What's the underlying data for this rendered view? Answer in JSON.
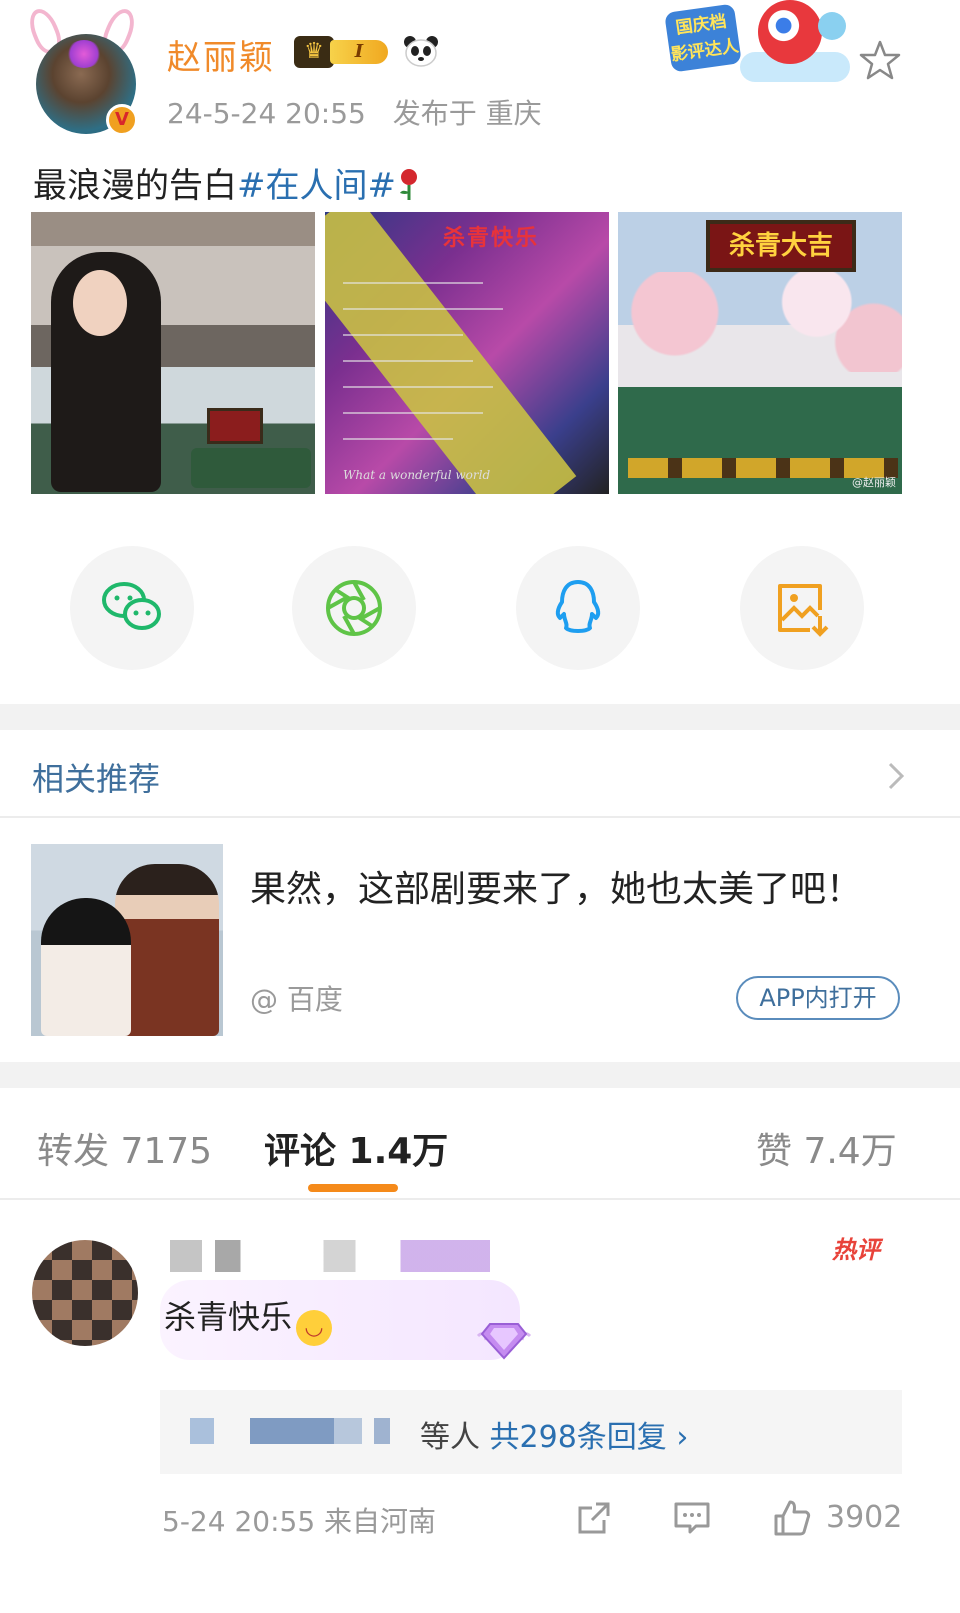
{
  "post": {
    "username": "赵丽颖",
    "level_badge": "I",
    "time": "24-5-24 20:55",
    "location": "发布于 重庆",
    "text_plain": "最浪漫的告白",
    "text_tag": "#在人间#",
    "event_badge": "国庆档 影评达人",
    "image3_sign": "杀青大吉",
    "image2_title": "杀青快乐",
    "image3_watermark": "@赵丽颖",
    "image2_caption": "What a wonderful world"
  },
  "share": {
    "items": [
      "wechat-icon",
      "moments-icon",
      "qq-icon",
      "save-image-icon"
    ]
  },
  "related": {
    "title": "相关推荐",
    "card": {
      "text": "果然，这部剧要来了，她也太美了吧！",
      "source": "@ 百度",
      "open_button": "APP内打开"
    }
  },
  "tabs": {
    "repost": "转发 7175",
    "comment": "评论 1.4万",
    "like": "赞 7.4万"
  },
  "comment": {
    "hot_label": "热评",
    "text": "杀青快乐",
    "reply_suffix": "等人",
    "reply_link": "共298条回复 ›",
    "time_location": "5-24 20:55 来自河南",
    "like_count": "3902"
  },
  "colors": {
    "accent": "#f58a1a",
    "link": "#2a6fb0",
    "username": "#f08a2a"
  }
}
